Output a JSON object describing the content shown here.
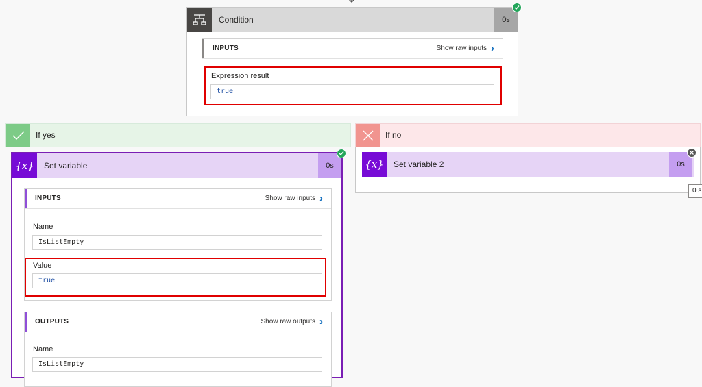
{
  "condition": {
    "title": "Condition",
    "duration": "0s",
    "inputs_label": "INPUTS",
    "show_raw_inputs": "Show raw inputs",
    "expression_label": "Expression result",
    "expression_value": "true"
  },
  "if_yes": {
    "title": "If yes"
  },
  "if_no": {
    "title": "If no"
  },
  "set_variable": {
    "icon_text": "{x}",
    "title": "Set variable",
    "duration": "0s",
    "inputs_label": "INPUTS",
    "show_raw_inputs": "Show raw inputs",
    "name_label": "Name",
    "name_value": "IsListEmpty",
    "value_label": "Value",
    "value_value": "true",
    "outputs_label": "OUTPUTS",
    "show_raw_outputs": "Show raw outputs",
    "out_name_label": "Name",
    "out_name_value": "IsListEmpty"
  },
  "set_variable_2": {
    "icon_text": "{x}",
    "title": "Set variable 2",
    "duration": "0s",
    "tooltip": "0 s"
  },
  "colors": {
    "success": "#23a55a",
    "failure_badge": "#555555",
    "variable_purple": "#770bd6",
    "highlight_red": "#e00000"
  }
}
